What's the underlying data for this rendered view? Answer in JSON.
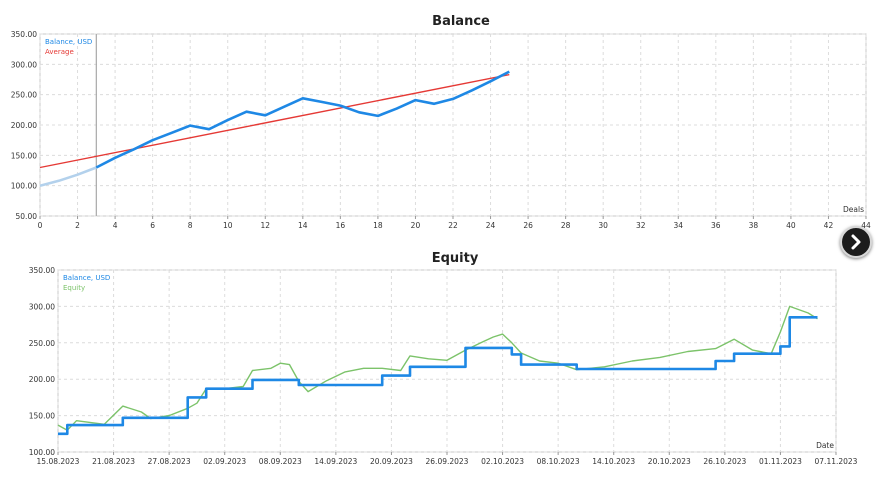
{
  "chart_data": [
    {
      "type": "line",
      "title": "Balance",
      "xlabel": "Deals",
      "xlim": [
        0,
        44
      ],
      "ylim": [
        50,
        350
      ],
      "x_ticks": [
        "0",
        "2",
        "4",
        "6",
        "8",
        "10",
        "12",
        "14",
        "16",
        "18",
        "20",
        "22",
        "24",
        "26",
        "28",
        "30",
        "32",
        "34",
        "36",
        "38",
        "40",
        "42",
        "44"
      ],
      "y_ticks": [
        "50.00",
        "100.00",
        "150.00",
        "200.00",
        "250.00",
        "300.00",
        "350.00"
      ],
      "grid": true,
      "legend_position": "top-left",
      "series": [
        {
          "name": "Balance, USD",
          "color": "#1e88e5",
          "points": [
            [
              0,
              100
            ],
            [
              1,
              108
            ],
            [
              2,
              118
            ],
            [
              3,
              130
            ],
            [
              4,
              146
            ],
            [
              5,
              160
            ],
            [
              6,
              175
            ],
            [
              7,
              187
            ],
            [
              8,
              199
            ],
            [
              9,
              193
            ],
            [
              10,
              208
            ],
            [
              11,
              222
            ],
            [
              12,
              216
            ],
            [
              13,
              230
            ],
            [
              14,
              244
            ],
            [
              15,
              238
            ],
            [
              16,
              232
            ],
            [
              17,
              221
            ],
            [
              18,
              215
            ],
            [
              19,
              227
            ],
            [
              20,
              241
            ],
            [
              21,
              235
            ],
            [
              22,
              243
            ],
            [
              23,
              257
            ],
            [
              24,
              272
            ],
            [
              25,
              288
            ]
          ]
        },
        {
          "name": "Average",
          "color": "#e53935",
          "points": [
            [
              0,
              130
            ],
            [
              25,
              283
            ]
          ]
        }
      ],
      "marker_x": 3
    },
    {
      "type": "line",
      "title": "Equity",
      "xlabel": "Date",
      "xlim": [
        "2023-08-15",
        "2023-11-07"
      ],
      "ylim": [
        100,
        350
      ],
      "x_ticks": [
        "15.08.2023",
        "21.08.2023",
        "27.08.2023",
        "02.09.2023",
        "08.09.2023",
        "14.09.2023",
        "20.09.2023",
        "26.09.2023",
        "02.10.2023",
        "08.10.2023",
        "14.10.2023",
        "20.10.2023",
        "26.10.2023",
        "01.11.2023",
        "07.11.2023"
      ],
      "y_ticks": [
        "100.00",
        "150.00",
        "200.00",
        "250.00",
        "300.00",
        "350.00"
      ],
      "grid": true,
      "legend_position": "top-left",
      "series": [
        {
          "name": "Balance, USD",
          "color": "#1e88e5",
          "points": [
            [
              "2023-08-15",
              125
            ],
            [
              "2023-08-16",
              125
            ],
            [
              "2023-08-16",
              137
            ],
            [
              "2023-08-22",
              137
            ],
            [
              "2023-08-22",
              147
            ],
            [
              "2023-08-29",
              147
            ],
            [
              "2023-08-29",
              175
            ],
            [
              "2023-08-31",
              175
            ],
            [
              "2023-08-31",
              187
            ],
            [
              "2023-09-05",
              187
            ],
            [
              "2023-09-05",
              199
            ],
            [
              "2023-09-10",
              199
            ],
            [
              "2023-09-10",
              192
            ],
            [
              "2023-09-19",
              192
            ],
            [
              "2023-09-19",
              205
            ],
            [
              "2023-09-22",
              205
            ],
            [
              "2023-09-22",
              217
            ],
            [
              "2023-09-28",
              217
            ],
            [
              "2023-09-28",
              243
            ],
            [
              "2023-10-03",
              243
            ],
            [
              "2023-10-03",
              234
            ],
            [
              "2023-10-04",
              234
            ],
            [
              "2023-10-04",
              220
            ],
            [
              "2023-10-10",
              220
            ],
            [
              "2023-10-10",
              214
            ],
            [
              "2023-10-25",
              214
            ],
            [
              "2023-10-25",
              225
            ],
            [
              "2023-10-27",
              225
            ],
            [
              "2023-10-27",
              235
            ],
            [
              "2023-11-01",
              235
            ],
            [
              "2023-11-01",
              245
            ],
            [
              "2023-11-02",
              245
            ],
            [
              "2023-11-02",
              285
            ],
            [
              "2023-11-05",
              285
            ]
          ]
        },
        {
          "name": "Equity",
          "color": "#7cc36a",
          "points": [
            [
              "2023-08-15",
              137
            ],
            [
              "2023-08-16",
              130
            ],
            [
              "2023-08-17",
              143
            ],
            [
              "2023-08-20",
              138
            ],
            [
              "2023-08-22",
              163
            ],
            [
              "2023-08-24",
              155
            ],
            [
              "2023-08-25",
              146
            ],
            [
              "2023-08-27",
              150
            ],
            [
              "2023-08-29",
              160
            ],
            [
              "2023-08-30",
              167
            ],
            [
              "2023-08-31",
              187
            ],
            [
              "2023-09-02",
              187
            ],
            [
              "2023-09-04",
              190
            ],
            [
              "2023-09-05",
              212
            ],
            [
              "2023-09-07",
              215
            ],
            [
              "2023-09-08",
              222
            ],
            [
              "2023-09-09",
              220
            ],
            [
              "2023-09-10",
              197
            ],
            [
              "2023-09-11",
              183
            ],
            [
              "2023-09-13",
              198
            ],
            [
              "2023-09-15",
              210
            ],
            [
              "2023-09-17",
              215
            ],
            [
              "2023-09-19",
              215
            ],
            [
              "2023-09-21",
              212
            ],
            [
              "2023-09-22",
              232
            ],
            [
              "2023-09-24",
              228
            ],
            [
              "2023-09-26",
              226
            ],
            [
              "2023-09-28",
              240
            ],
            [
              "2023-09-30",
              252
            ],
            [
              "2023-10-01",
              258
            ],
            [
              "2023-10-02",
              262
            ],
            [
              "2023-10-03",
              250
            ],
            [
              "2023-10-04",
              236
            ],
            [
              "2023-10-06",
              225
            ],
            [
              "2023-10-08",
              222
            ],
            [
              "2023-10-10",
              213
            ],
            [
              "2023-10-13",
              217
            ],
            [
              "2023-10-16",
              225
            ],
            [
              "2023-10-19",
              230
            ],
            [
              "2023-10-22",
              238
            ],
            [
              "2023-10-25",
              242
            ],
            [
              "2023-10-27",
              255
            ],
            [
              "2023-10-29",
              240
            ],
            [
              "2023-10-31",
              235
            ],
            [
              "2023-11-01",
              265
            ],
            [
              "2023-11-02",
              300
            ],
            [
              "2023-11-04",
              291
            ],
            [
              "2023-11-05",
              283
            ]
          ]
        }
      ]
    }
  ]
}
